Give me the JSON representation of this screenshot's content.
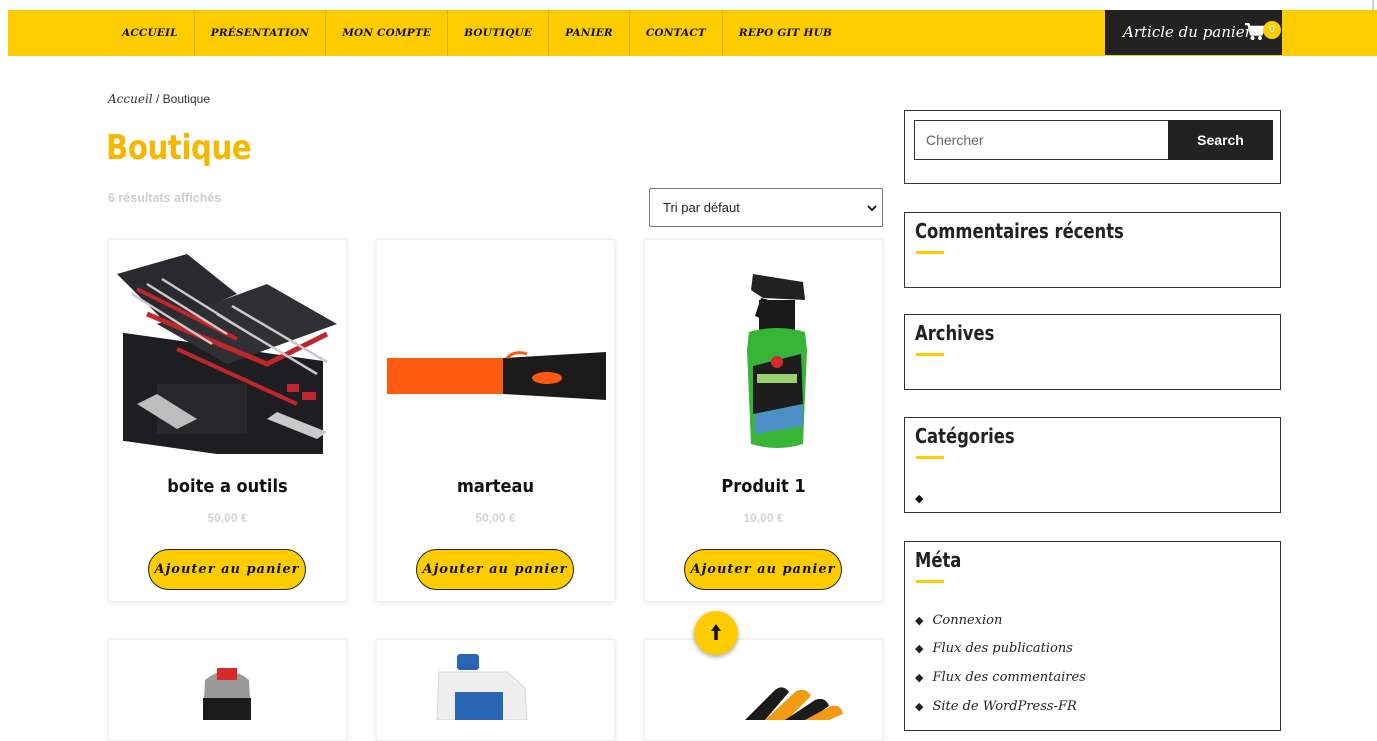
{
  "nav": {
    "items": [
      "Accueil",
      "Présentation",
      "Mon compte",
      "Boutique",
      "Panier",
      "Contact",
      "Repo git hub"
    ],
    "cart_label": "Article du panier",
    "cart_count": "0",
    "cart_icon": "cart-icon"
  },
  "breadcrumb": {
    "home": "Accueil",
    "separator": "/",
    "current": "Boutique"
  },
  "page": {
    "title": "Boutique",
    "result_count": "6 résultats affichés",
    "sort_selected": "Tri par défaut"
  },
  "products": [
    {
      "name": "boite a outils",
      "price": "50,00 €",
      "button": "Ajouter au panier"
    },
    {
      "name": "marteau",
      "price": "50,00 €",
      "button": "Ajouter au panier"
    },
    {
      "name": "Produit 1",
      "price": "10,00 €",
      "button": "Ajouter au panier"
    }
  ],
  "scroll_top_icon": "arrow-up-icon",
  "sidebar": {
    "search": {
      "placeholder": "Chercher",
      "button": "Search"
    },
    "recent_comments": {
      "title": "Commentaires récents"
    },
    "archives": {
      "title": "Archives"
    },
    "categories": {
      "title": "Catégories"
    },
    "meta": {
      "title": "Méta",
      "items": [
        "Connexion",
        "Flux des publications",
        "Flux des commentaires",
        "Site de WordPress-FR"
      ]
    }
  },
  "colors": {
    "accent": "#ffcc00",
    "dark": "#222222",
    "title": "#f5b800"
  }
}
